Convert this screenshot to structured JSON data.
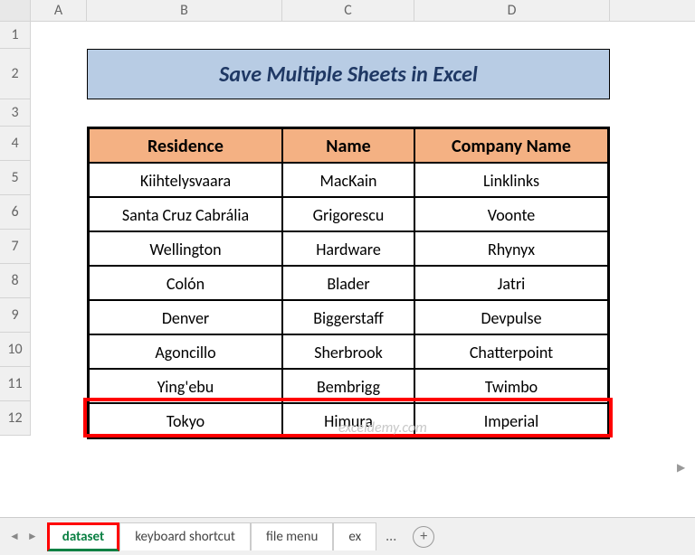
{
  "columns": [
    "A",
    "B",
    "C",
    "D"
  ],
  "rows": [
    "1",
    "2",
    "3",
    "4",
    "5",
    "6",
    "7",
    "8",
    "9",
    "10",
    "11",
    "12"
  ],
  "title": "Save Multiple Sheets in Excel",
  "headers": {
    "residence": "Residence",
    "name": "Name",
    "company": "Company Name"
  },
  "data": [
    {
      "residence": "Kiihtelysvaara",
      "name": "MacKain",
      "company": "Linklinks"
    },
    {
      "residence": "Santa Cruz Cabrália",
      "name": "Grigorescu",
      "company": "Voonte"
    },
    {
      "residence": "Wellington",
      "name": "Hardware",
      "company": "Rhynyx"
    },
    {
      "residence": "Colón",
      "name": "Blader",
      "company": "Jatri"
    },
    {
      "residence": "Denver",
      "name": "Biggerstaff",
      "company": "Devpulse"
    },
    {
      "residence": "Agoncillo",
      "name": "Sherbrook",
      "company": "Chatterpoint"
    },
    {
      "residence": "Ying'ebu",
      "name": "Bembrigg",
      "company": "Twimbo"
    },
    {
      "residence": "Tokyo",
      "name": "Himura",
      "company": "Imperial"
    }
  ],
  "tabs": {
    "active": "dataset",
    "t2": "keyboard shortcut",
    "t3": "file menu",
    "t4": "ex",
    "more": "...",
    "add": "+"
  },
  "watermark": "exceldemy.com",
  "chart_data": {
    "type": "table",
    "title": "Save Multiple Sheets in Excel",
    "columns": [
      "Residence",
      "Name",
      "Company Name"
    ],
    "rows": [
      [
        "Kiihtelysvaara",
        "MacKain",
        "Linklinks"
      ],
      [
        "Santa Cruz Cabrália",
        "Grigorescu",
        "Voonte"
      ],
      [
        "Wellington",
        "Hardware",
        "Rhynyx"
      ],
      [
        "Colón",
        "Blader",
        "Jatri"
      ],
      [
        "Denver",
        "Biggerstaff",
        "Devpulse"
      ],
      [
        "Agoncillo",
        "Sherbrook",
        "Chatterpoint"
      ],
      [
        "Ying'ebu",
        "Bembrigg",
        "Twimbo"
      ],
      [
        "Tokyo",
        "Himura",
        "Imperial"
      ]
    ]
  }
}
